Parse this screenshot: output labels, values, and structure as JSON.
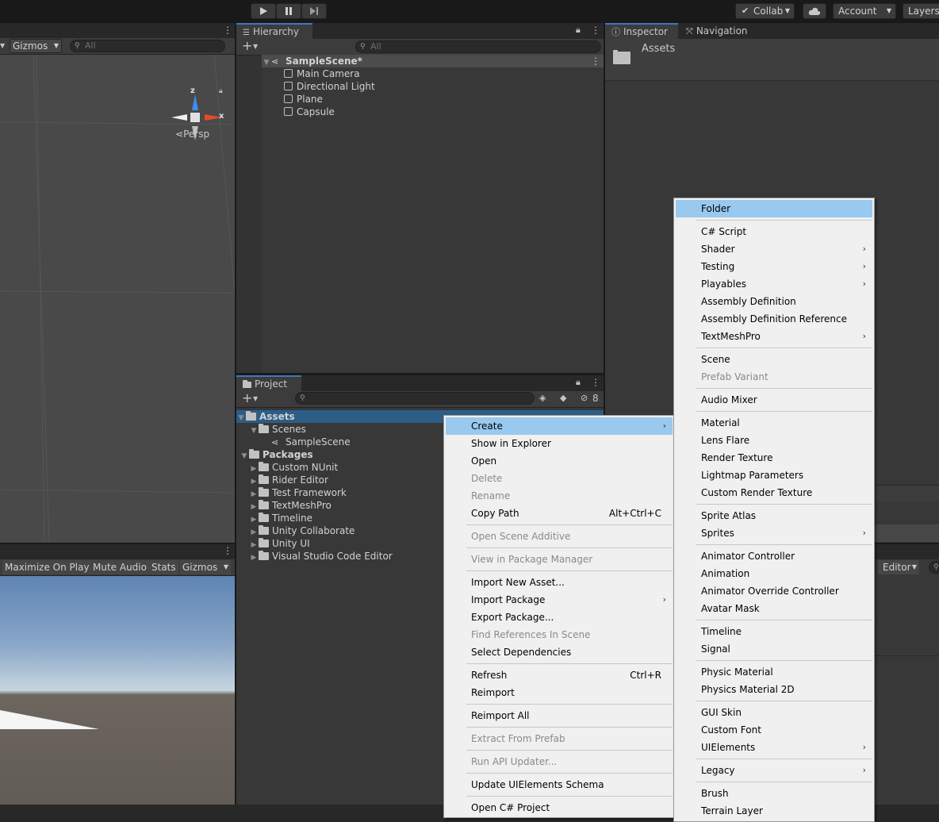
{
  "toolbar": {
    "collab_label": "Collab",
    "account_label": "Account",
    "layers_label": "Layers"
  },
  "scene": {
    "gizmos_label": "Gizmos",
    "search_placeholder": "All",
    "persp_label": "Persp",
    "axis_x": "x",
    "axis_z": "z"
  },
  "game": {
    "buttons": [
      "Maximize On Play",
      "Mute Audio",
      "Stats",
      "Gizmos"
    ]
  },
  "hierarchy": {
    "tab_label": "Hierarchy",
    "search_placeholder": "All",
    "scene_name": "SampleScene*",
    "objects": [
      "Main Camera",
      "Directional Light",
      "Plane",
      "Capsule"
    ]
  },
  "inspector": {
    "tab_label": "Inspector",
    "nav_tab_label": "Navigation",
    "asset_title": "Assets",
    "editor_label": "Editor"
  },
  "project": {
    "tab_label": "Project",
    "hidden_count": "8",
    "tree": {
      "assets": "Assets",
      "scenes": "Scenes",
      "sample_scene": "SampleScene",
      "packages": "Packages",
      "package_items": [
        "Custom NUnit",
        "Rider Editor",
        "Test Framework",
        "TextMeshPro",
        "Timeline",
        "Unity Collaborate",
        "Unity UI",
        "Visual Studio Code Editor"
      ]
    }
  },
  "context_menu": {
    "create": "Create",
    "show_in_explorer": "Show in Explorer",
    "open": "Open",
    "delete": "Delete",
    "rename": "Rename",
    "copy_path": "Copy Path",
    "copy_path_shortcut": "Alt+Ctrl+C",
    "open_scene_additive": "Open Scene Additive",
    "view_in_package_manager": "View in Package Manager",
    "import_new_asset": "Import New Asset...",
    "import_package": "Import Package",
    "export_package": "Export Package...",
    "find_references": "Find References In Scene",
    "select_dependencies": "Select Dependencies",
    "refresh": "Refresh",
    "refresh_shortcut": "Ctrl+R",
    "reimport": "Reimport",
    "reimport_all": "Reimport All",
    "extract_from_prefab": "Extract From Prefab",
    "run_api_updater": "Run API Updater...",
    "update_uielements_schema": "Update UIElements Schema",
    "open_csharp_project": "Open C# Project"
  },
  "create_menu": {
    "folder": "Folder",
    "csharp_script": "C# Script",
    "shader": "Shader",
    "testing": "Testing",
    "playables": "Playables",
    "assembly_definition": "Assembly Definition",
    "assembly_definition_reference": "Assembly Definition Reference",
    "textmeshpro": "TextMeshPro",
    "scene": "Scene",
    "prefab_variant": "Prefab Variant",
    "audio_mixer": "Audio Mixer",
    "material": "Material",
    "lens_flare": "Lens Flare",
    "render_texture": "Render Texture",
    "lightmap_parameters": "Lightmap Parameters",
    "custom_render_texture": "Custom Render Texture",
    "sprite_atlas": "Sprite Atlas",
    "sprites": "Sprites",
    "animator_controller": "Animator Controller",
    "animation": "Animation",
    "animator_override_controller": "Animator Override Controller",
    "avatar_mask": "Avatar Mask",
    "timeline": "Timeline",
    "signal": "Signal",
    "physic_material": "Physic Material",
    "physics_material_2d": "Physics Material 2D",
    "gui_skin": "GUI Skin",
    "custom_font": "Custom Font",
    "uielements": "UIElements",
    "legacy": "Legacy",
    "brush": "Brush",
    "terrain_layer": "Terrain Layer"
  }
}
